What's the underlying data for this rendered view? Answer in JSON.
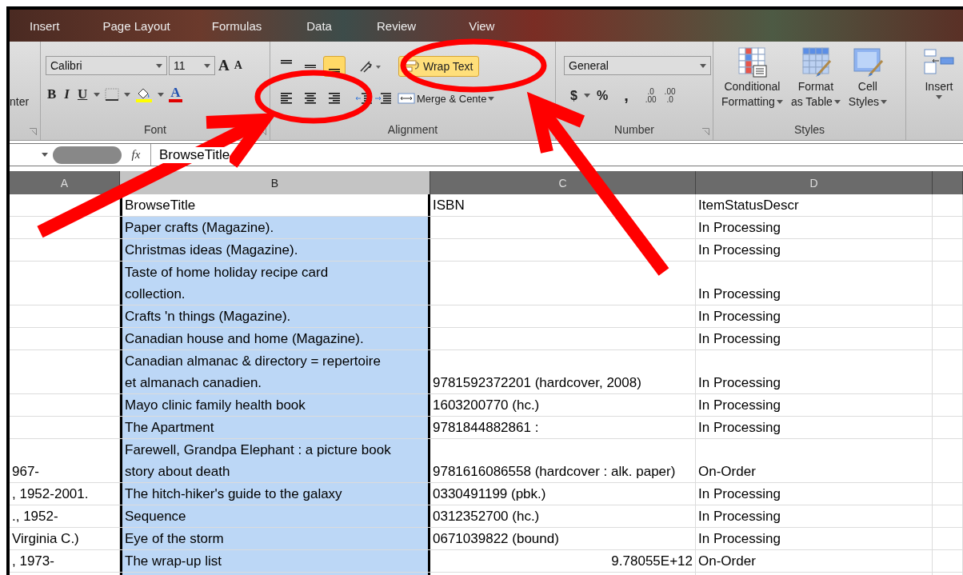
{
  "tabs": [
    {
      "label": "Insert",
      "selected": false
    },
    {
      "label": "Page Layout",
      "selected": false
    },
    {
      "label": "Formulas",
      "selected": false
    },
    {
      "label": "Data",
      "selected": false
    },
    {
      "label": "Review",
      "selected": false
    },
    {
      "label": "View",
      "selected": false
    }
  ],
  "ribbon": {
    "cut_group": {
      "label": "nter"
    },
    "font_group": {
      "label": "Font",
      "font_name": "Calibri",
      "font_size": "11",
      "grow_font": "A",
      "shrink_font": "A",
      "bold": "B",
      "italic": "I",
      "underline": "U",
      "font_color": "A"
    },
    "alignment_group": {
      "label": "Alignment",
      "vertical": [
        {
          "kind": "top",
          "selected": false
        },
        {
          "kind": "middle",
          "selected": false
        },
        {
          "kind": "bottom",
          "selected": true
        }
      ],
      "wrap_text": {
        "label": "Wrap Text",
        "selected": true
      },
      "horizontal": [
        {
          "kind": "left",
          "selected": false
        },
        {
          "kind": "center",
          "selected": false
        },
        {
          "kind": "right",
          "selected": false
        }
      ],
      "merge": {
        "label": "Merge & Cente"
      }
    },
    "number_group": {
      "label": "Number",
      "format": "General",
      "currency": "$",
      "percent": "%",
      "comma": ",",
      "increase_decimal": {
        "top": ".0",
        "bottom": ".00"
      },
      "decrease_decimal": {
        "top": ".00",
        "bottom": ".0"
      }
    },
    "styles_group": {
      "label": "Styles",
      "buttons": [
        {
          "kind": "conditional",
          "lines": [
            "Conditional",
            "Formatting"
          ]
        },
        {
          "kind": "table",
          "lines": [
            "Format",
            "as Table"
          ]
        },
        {
          "kind": "cell",
          "lines": [
            "Cell",
            "Styles"
          ]
        }
      ]
    },
    "cells_group": {
      "insert": "Insert"
    }
  },
  "formula_bar": {
    "fx": "fx",
    "value": "BrowseTitle"
  },
  "sheet": {
    "columns": [
      {
        "label": "A",
        "selected": false
      },
      {
        "label": "B",
        "selected": true
      },
      {
        "label": "C",
        "selected": false
      },
      {
        "label": "D",
        "selected": false
      }
    ],
    "rows": [
      {
        "a": "",
        "b": "BrowseTitle",
        "c": "ISBN",
        "d": "ItemStatusDescr",
        "active": true,
        "c_numeric": false
      },
      {
        "a": "",
        "b": "Paper crafts (Magazine).",
        "c": "",
        "d": "In Processing",
        "active": false
      },
      {
        "a": "",
        "b": "Christmas ideas (Magazine).",
        "c": "",
        "d": "In Processing",
        "active": false
      },
      {
        "a": "",
        "b": "Taste of home holiday recipe card\ncollection.",
        "c": "",
        "d": "In Processing",
        "active": false
      },
      {
        "a": "",
        "b": "Crafts 'n things (Magazine).",
        "c": "",
        "d": "In Processing",
        "active": false
      },
      {
        "a": "",
        "b": "Canadian house and home (Magazine).",
        "c": "",
        "d": "In Processing",
        "active": false
      },
      {
        "a": "",
        "b": "Canadian almanac & directory = repertoire\net almanach canadien.",
        "c": "9781592372201 (hardcover, 2008)",
        "d": "In Processing",
        "active": false,
        "c_numeric": false
      },
      {
        "a": "",
        "b": "Mayo clinic family health book",
        "c": "1603200770 (hc.)",
        "d": "In Processing",
        "active": false,
        "c_numeric": false
      },
      {
        "a": "",
        "b": "The Apartment",
        "c": "9781844882861 :",
        "d": "In Processing",
        "active": false,
        "c_numeric": false
      },
      {
        "a": "967-",
        "b": "Farewell, Grandpa Elephant : a picture book\nstory about death",
        "c": "9781616086558 (hardcover : alk. paper)",
        "d": "On-Order",
        "active": false,
        "c_numeric": false
      },
      {
        "a": ", 1952-2001.",
        "b": "The hitch-hiker's guide to the galaxy",
        "c": "0330491199 (pbk.)",
        "d": "In Processing",
        "active": false,
        "c_numeric": false
      },
      {
        "a": "., 1952-",
        "b": "Sequence",
        "c": "0312352700 (hc.)",
        "d": "In Processing",
        "active": false,
        "c_numeric": false
      },
      {
        "a": "Virginia C.)",
        "b": "Eye of the storm",
        "c": "0671039822 (bound)",
        "d": "In Processing",
        "active": false,
        "c_numeric": false
      },
      {
        "a": ", 1973-",
        "b": "The wrap-up list",
        "c": "9.78055E+12",
        "d": "On-Order",
        "active": false,
        "c_numeric": true
      },
      {
        "a": "",
        "b": "",
        "c": "",
        "d": "",
        "active": false
      }
    ]
  }
}
